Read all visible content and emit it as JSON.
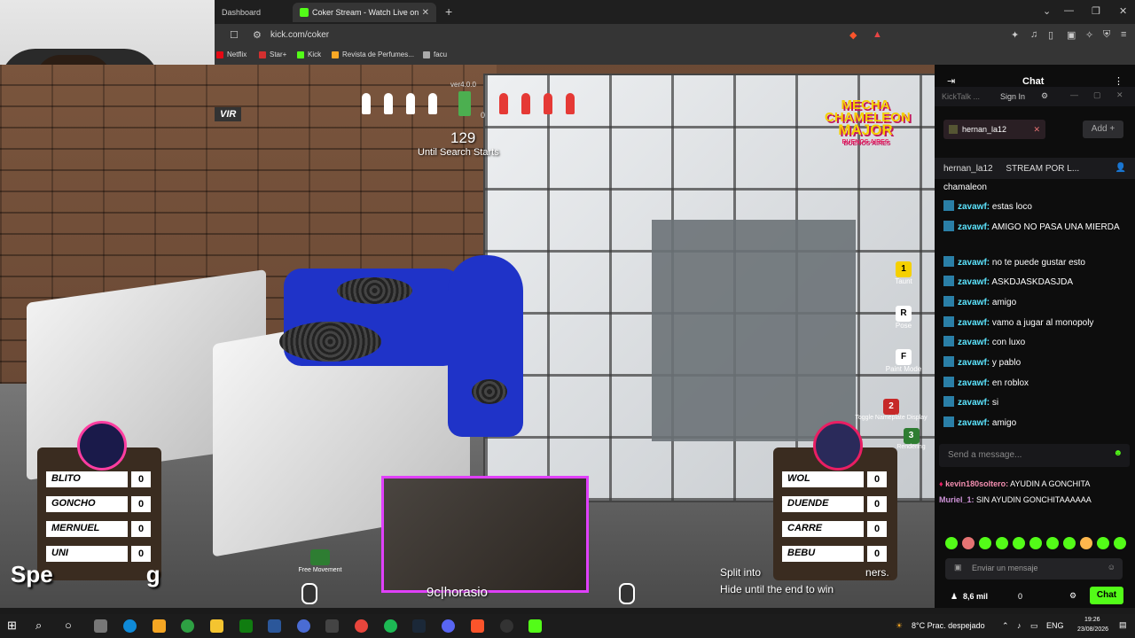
{
  "browser": {
    "tabs": [
      {
        "label": "Dashboard"
      },
      {
        "label": "Coker Stream - Watch Live on"
      }
    ],
    "url": "kick.com/coker",
    "bookmarks": [
      "Netflix",
      "Star+",
      "Kick",
      "Revista de Perfumes...",
      "facu"
    ]
  },
  "game": {
    "version": "ver4.0.0",
    "search_count": "129",
    "search_text": "Until Search Starts",
    "search_pct": "0",
    "team_tag": "VIR",
    "logo": [
      "MECHA",
      "CHAMELEON",
      "MAJOR",
      "BUENOS AIRES"
    ],
    "left_team": [
      {
        "name": "BLITO",
        "score": "0"
      },
      {
        "name": "GONCHO",
        "score": "0"
      },
      {
        "name": "MERNUEL",
        "score": "0"
      },
      {
        "name": "UNI",
        "score": "0"
      }
    ],
    "right_team": [
      {
        "name": "WOL",
        "score": "0"
      },
      {
        "name": "DUENDE",
        "score": "0"
      },
      {
        "name": "CARRE",
        "score": "0"
      },
      {
        "name": "BEBU",
        "score": "0"
      }
    ],
    "keyhints": [
      {
        "key": "1",
        "label": "Taunt"
      },
      {
        "key": "R",
        "label": "Pose"
      },
      {
        "key": "F",
        "label": "Paint Mode"
      },
      {
        "key": "2",
        "label": "Toggle Nameplate Display"
      },
      {
        "key": "3",
        "label": "Rendering"
      }
    ],
    "free_movement": "Free Movement",
    "camfeed_name": "9c|horasio",
    "split_text_1": "Split into",
    "split_text_1_end": "ners.",
    "split_text_2": "Hide until the end to win",
    "spec_text": "Spe",
    "spec_text_end": "g"
  },
  "chat": {
    "title": "Chat",
    "kicktalk": "KickTalk ...",
    "sign_in": "Sign In",
    "user_tab": "hernan_la12",
    "add_label": "Add",
    "pinned_user": "hernan_la12",
    "pinned_text": "STREAM POR L...",
    "messages": [
      {
        "user": "",
        "text": "chamaleon"
      },
      {
        "user": "zavawf:",
        "text": "estas loco"
      },
      {
        "user": "zavawf:",
        "text": "AMIGO NO PASA UNA MIERDA"
      },
      {
        "user": "zavawf:",
        "text": "no te puede gustar esto"
      },
      {
        "user": "zavawf:",
        "text": "ASKDJASKDASJDA"
      },
      {
        "user": "zavawf:",
        "text": "amigo"
      },
      {
        "user": "zavawf:",
        "text": "vamo a jugar al monopoly"
      },
      {
        "user": "zavawf:",
        "text": "con luxo"
      },
      {
        "user": "zavawf:",
        "text": "y pablo"
      },
      {
        "user": "zavawf:",
        "text": "en roblox"
      },
      {
        "user": "zavawf:",
        "text": "si"
      },
      {
        "user": "zavawf:",
        "text": "amigo"
      }
    ],
    "send_placeholder": "Send a message...",
    "chat2": [
      {
        "user": "kevin180soltero:",
        "text": "AYUDIN A GONCHITA"
      },
      {
        "user": "Muriel_1:",
        "text": "SIN AYUDIN GONCHITAAAAAA"
      }
    ],
    "enviar_placeholder": "Enviar un mensaje",
    "viewers": "8,6 mil",
    "count": "0",
    "chat_button": "Chat"
  },
  "taskbar": {
    "weather": "8°C  Prac. despejado",
    "lang": "ENG",
    "time": "19:26",
    "date": "23/08/2026"
  },
  "colors": {
    "kick_green": "#53fc18",
    "chat_user": "#5ce5ff"
  }
}
